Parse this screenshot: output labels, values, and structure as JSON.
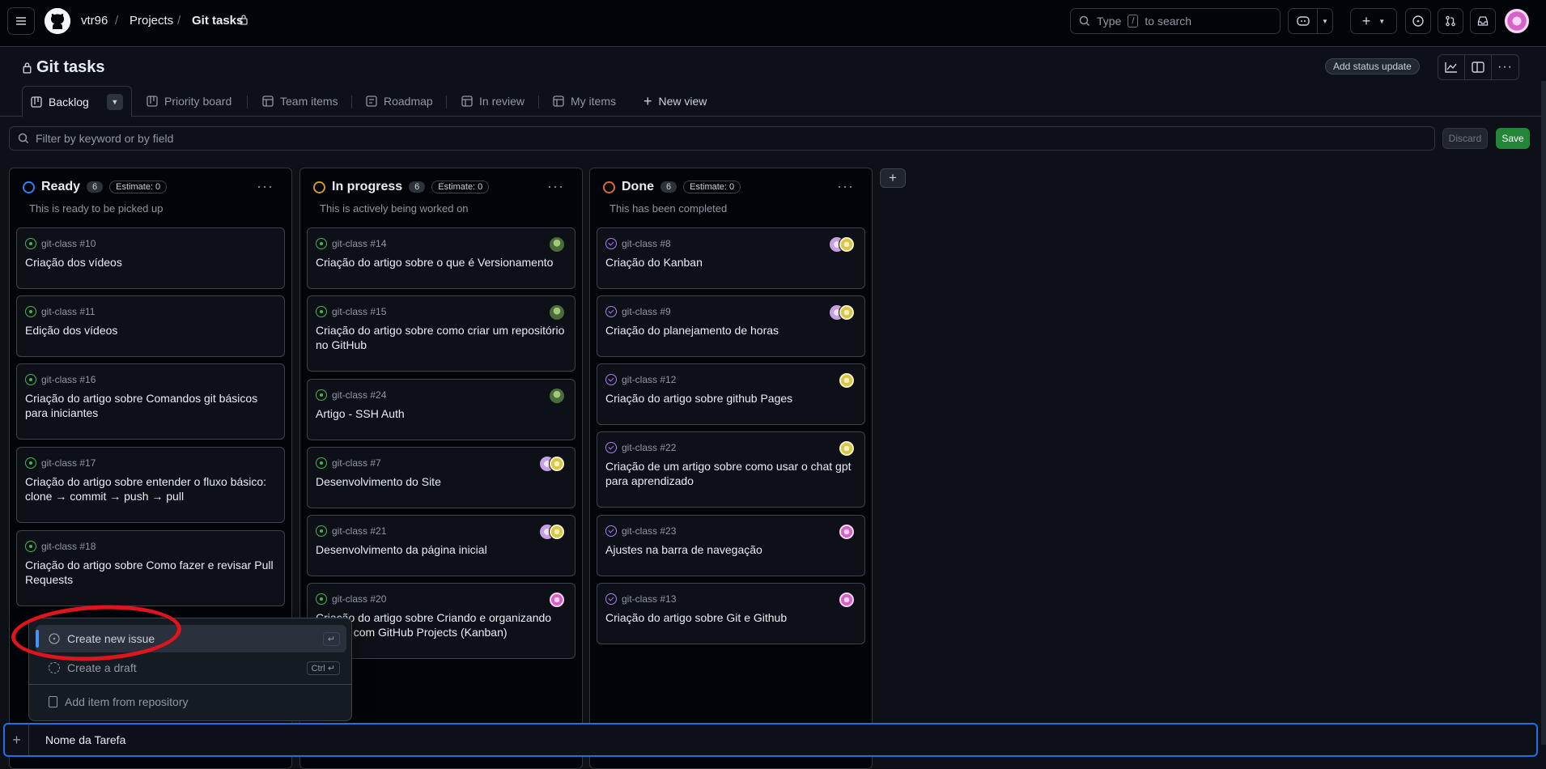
{
  "header": {
    "owner": "vtr96",
    "projects_link": "Projects",
    "project_name": "Git tasks",
    "search_prefix": "Type",
    "search_key": "/",
    "search_suffix": "to search"
  },
  "project": {
    "title": "Git tasks",
    "status_button": "Add status update"
  },
  "tabs": [
    {
      "label": "Backlog"
    },
    {
      "label": "Priority board"
    },
    {
      "label": "Team items"
    },
    {
      "label": "Roadmap"
    },
    {
      "label": "In review"
    },
    {
      "label": "My items"
    },
    {
      "label": "New view"
    }
  ],
  "filter": {
    "placeholder": "Filter by keyword or by field",
    "discard": "Discard",
    "save": "Save"
  },
  "columns": [
    {
      "name": "Ready",
      "count": "6",
      "estimate": "Estimate: 0",
      "description": "This is ready to be picked up",
      "dot_color": "#2f81f7",
      "cards": [
        {
          "ref": "git-class #10",
          "title": "Criação dos vídeos",
          "avatars": []
        },
        {
          "ref": "git-class #11",
          "title": "Edição dos vídeos",
          "avatars": []
        },
        {
          "ref": "git-class #16",
          "title": "Criação do artigo sobre Comandos git básicos para iniciantes",
          "avatars": []
        },
        {
          "ref": "git-class #17",
          "title": "Criação do artigo sobre entender o fluxo básico: clone → commit → push → pull",
          "avatars": []
        },
        {
          "ref": "git-class #18",
          "title": "Criação do artigo sobre Como fazer e revisar Pull Requests",
          "avatars": []
        }
      ]
    },
    {
      "name": "In progress",
      "count": "6",
      "estimate": "Estimate: 0",
      "description": "This is actively being worked on",
      "dot_color": "#d29922",
      "cards": [
        {
          "ref": "git-class #14",
          "title": "Criação do artigo sobre o que é Versionamento",
          "avatars": [
            "green"
          ]
        },
        {
          "ref": "git-class #15",
          "title": "Criação do artigo sobre como criar um repositório no GitHub",
          "avatars": [
            "green"
          ]
        },
        {
          "ref": "git-class #24",
          "title": "Artigo - SSH Auth",
          "avatars": [
            "green"
          ]
        },
        {
          "ref": "git-class #7",
          "title": "Desenvolvimento do Site",
          "avatars": [
            "lilac",
            "yellow"
          ]
        },
        {
          "ref": "git-class #21",
          "title": "Desenvolvimento da página inicial",
          "avatars": [
            "lilac",
            "yellow"
          ]
        },
        {
          "ref": "git-class #20",
          "title": "Criação do artigo sobre Criando e organizando tarefas com GitHub Projects (Kanban)",
          "avatars": [
            "pink"
          ]
        }
      ]
    },
    {
      "name": "Done",
      "count": "6",
      "estimate": "Estimate: 0",
      "description": "This has been completed",
      "dot_color": "#db6d28",
      "cards": [
        {
          "ref": "git-class #8",
          "title": "Criação do Kanban",
          "avatars": [
            "lilac",
            "yellow"
          ]
        },
        {
          "ref": "git-class #9",
          "title": "Criação do planejamento de horas",
          "avatars": [
            "lilac",
            "yellow"
          ]
        },
        {
          "ref": "git-class #12",
          "title": "Criação do artigo sobre github Pages",
          "avatars": [
            "yellow"
          ]
        },
        {
          "ref": "git-class #22",
          "title": "Criação de um artigo sobre como usar o chat gpt para aprendizado",
          "avatars": [
            "yellow"
          ]
        },
        {
          "ref": "git-class #23",
          "title": "Ajustes na barra de navegação",
          "avatars": [
            "pink"
          ]
        },
        {
          "ref": "git-class #13",
          "title": "Criação do artigo sobre Git e Github",
          "avatars": [
            "pink"
          ]
        }
      ]
    }
  ],
  "menu": {
    "create_issue": "Create new issue",
    "create_draft": "Create a draft",
    "draft_shortcut": "Ctrl ↵",
    "add_from_repo": "Add item from repository",
    "issue_shortcut": "↵"
  },
  "new_item": {
    "value": "Nome da Tarefa"
  },
  "colors": {
    "accent": "#1f6feb",
    "save_green": "#238636",
    "annotation_red": "#e0141d"
  }
}
